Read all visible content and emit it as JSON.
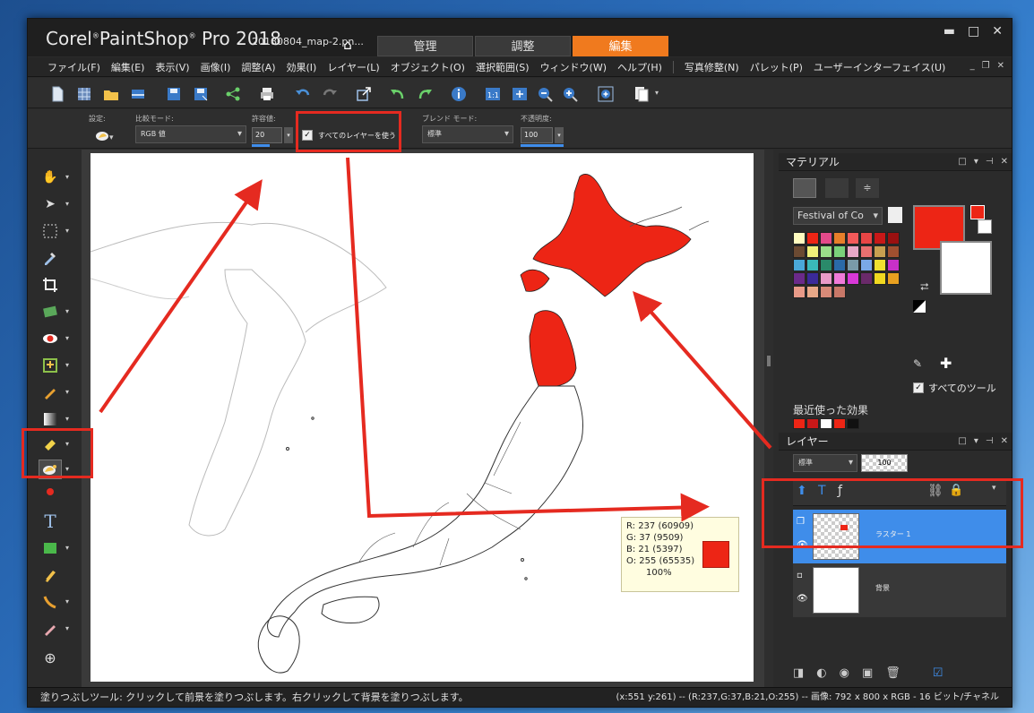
{
  "app": {
    "brand": "Corel PaintShop Pro 2018",
    "brand_parts": [
      "Corel",
      "PaintShop",
      "Pro 2018"
    ],
    "document": "20180804_map-2.pn..."
  },
  "tabs": [
    {
      "label": "管理",
      "active": false
    },
    {
      "label": "調整",
      "active": false
    },
    {
      "label": "編集",
      "active": true
    }
  ],
  "window_controls": [
    "▬",
    "□",
    "✕"
  ],
  "menu": [
    "ファイル(F)",
    "編集(E)",
    "表示(V)",
    "画像(I)",
    "調整(A)",
    "効果(I)",
    "レイヤー(L)",
    "オブジェクト(O)",
    "選択範囲(S)",
    "ウィンドウ(W)",
    "ヘルプ(H)",
    "写真修整(N)",
    "パレット(P)",
    "ユーザーインターフェイス(U)"
  ],
  "options": {
    "preset_label": "設定:",
    "compare_label": "比較モード:",
    "compare_value": "RGB 値",
    "tolerance_label": "許容値:",
    "tolerance_value": "20",
    "all_layers_label": "すべてのレイヤーを使う",
    "all_layers_checked": true,
    "blend_label": "ブレンド モード:",
    "blend_value": "標準",
    "opacity_label": "不透明度:",
    "opacity_value": "100"
  },
  "pixel_info": {
    "r": "R: 237  (60909)",
    "g": "G: 37  (9509)",
    "b": "B: 21  (5397)",
    "o": "O: 255  (65535)",
    "pct": "100%",
    "color": "#ed2515"
  },
  "materials": {
    "title": "マテリアル",
    "swatch_set": "Festival of Co",
    "all_tools_label": "すべてのツール",
    "recent_effects_label": "最近使った効果",
    "foreground": "#ed2515",
    "background": "#ffffff",
    "palette": [
      "#fffcc0",
      "#ed2515",
      "#e44a8a",
      "#e87f2a",
      "#f45a5a",
      "#e84545",
      "#c81818",
      "#9a1010",
      "#6b4a32",
      "#f0f07a",
      "#9adf8a",
      "#7ad27a",
      "#e8a8c8",
      "#e87070",
      "#c8a050",
      "#a05030",
      "#4aa8d8",
      "#3ab8b8",
      "#2a8a6a",
      "#2a6aa8",
      "#7a9aa8",
      "#7aa8e8",
      "#f0e030",
      "#c830c8",
      "#6a2a8a",
      "#3a2a9a",
      "#e89ac8",
      "#f07ad8",
      "#d838d8",
      "#6a2a6a",
      "#f0d820",
      "#e8a020",
      "#e89a88",
      "#e8a888",
      "#d88a78",
      "#c87868"
    ],
    "recent_effects": [
      "#ed2515",
      "#c81818",
      "#ffffff",
      "#ed2515",
      "#111111"
    ]
  },
  "layers": {
    "title": "レイヤー",
    "blend": "標準",
    "opacity": "100",
    "items": [
      {
        "name": "ラスター 1",
        "selected": true
      },
      {
        "name": "背景",
        "selected": false
      }
    ]
  },
  "status": {
    "left": "塗りつぶしツール: クリックして前景を塗りつぶします。右クリックして背景を塗りつぶします。",
    "right": "(x:551 y:261) -- (R:237,G:37,B:21,O:255) -- 画像: 792 x 800 x RGB - 16 ビット/チャネル"
  },
  "colors": {
    "accent_tab": "#f07a1e",
    "annotation": "#e52a20",
    "selection": "#3f8dea",
    "fill": "#ed2515"
  }
}
